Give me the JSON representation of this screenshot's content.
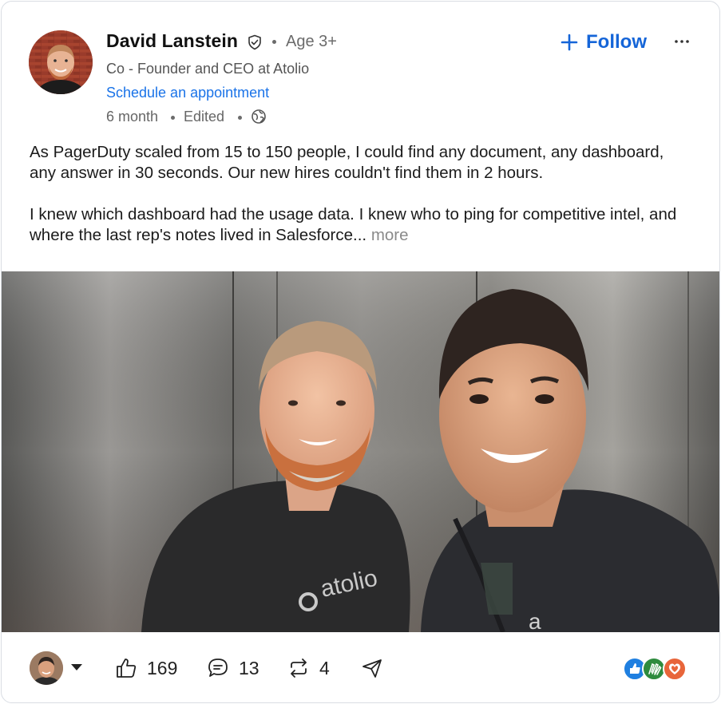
{
  "author": {
    "name": "David Lanstein",
    "age": "Age 3+",
    "headline": "Co - Founder and CEO at Atolio",
    "schedule_link": "Schedule an appointment",
    "time": "6 month",
    "edited": "Edited",
    "avatar_icon": "profile-photo"
  },
  "actions": {
    "follow_label": "Follow",
    "more_icon": "ellipsis-icon"
  },
  "post": {
    "paragraph_1": "As PagerDuty scaled from 15 to 150 people, I could find any document, any dashboard, any answer in 30 seconds. Our new hires couldn't find them in 2 hours.",
    "paragraph_2": "I knew which dashboard had the usage data. I knew who to ping for competitive intel, and where the last rep's notes lived in Salesforce...",
    "more_label": "more",
    "photo_shirt_text": "atolio"
  },
  "footer": {
    "likes": "169",
    "comments": "13",
    "reposts": "4",
    "reaction_icons": [
      "thumbs-up-icon",
      "clapping-hands-icon",
      "heart-icon"
    ]
  },
  "colors": {
    "accent": "#1565d8",
    "link": "#1a73e8",
    "reaction_like": "#1f7fe0",
    "reaction_celebrate": "#2e8b3e",
    "reaction_love": "#e8653a"
  }
}
